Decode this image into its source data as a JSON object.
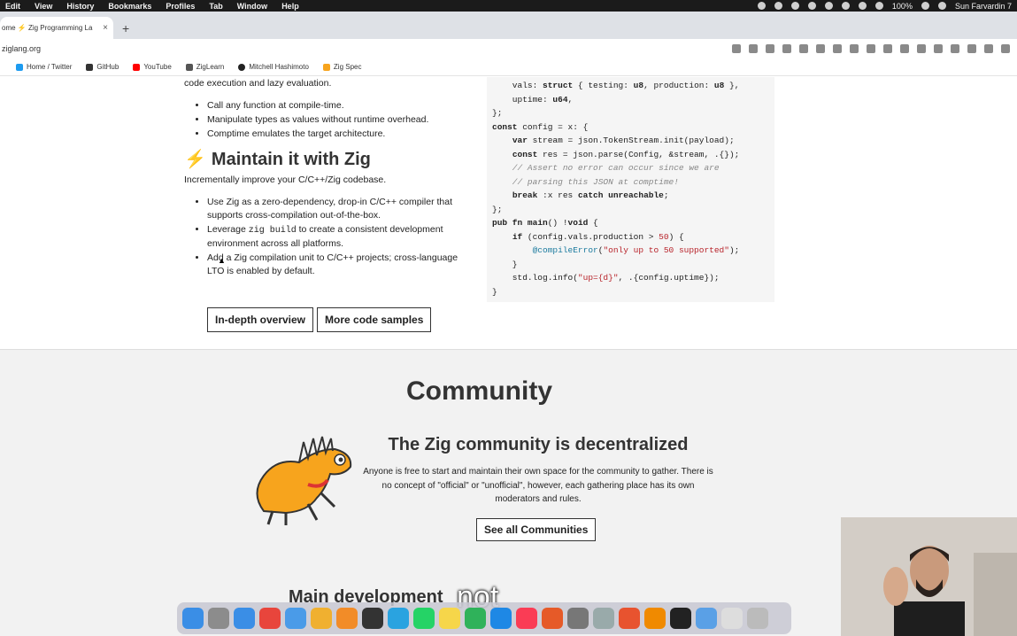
{
  "menubar": {
    "items": [
      "Edit",
      "View",
      "History",
      "Bookmarks",
      "Profiles",
      "Tab",
      "Window",
      "Help"
    ],
    "battery": "100%",
    "clock": "Sun Farvardin 7"
  },
  "tab": {
    "title": "ome ⚡ Zig Programming La",
    "close": "×",
    "new_tab": "+"
  },
  "address": {
    "url": "ziglang.org"
  },
  "bookmarks": [
    {
      "label": "Home / Twitter",
      "color": "#1d9bf0"
    },
    {
      "label": "GitHub",
      "color": "#333333"
    },
    {
      "label": "YouTube",
      "color": "#ff0000"
    },
    {
      "label": "ZigLearn",
      "color": "#555555"
    },
    {
      "label": "Mitchell Hashimoto",
      "color": "#222222"
    },
    {
      "label": "Zig Spec",
      "color": "#f7a41d"
    }
  ],
  "left": {
    "intro_tail": "code execution and lazy evaluation.",
    "comptime_bullets": [
      "Call any function at compile-time.",
      "Manipulate types as values without runtime overhead.",
      "Comptime emulates the target architecture."
    ],
    "maintain_heading": "Maintain it with Zig",
    "maintain_intro": "Incrementally improve your C/C++/Zig codebase.",
    "maintain_bullet1": "Use Zig as a zero-dependency, drop-in C/C++ compiler that supports cross-compilation out-of-the-box.",
    "maintain_bullet2_pre": "Leverage ",
    "maintain_bullet2_code": "zig build",
    "maintain_bullet2_post": " to create a consistent development environment across all platforms.",
    "maintain_bullet3": "Add a Zig compilation unit to C/C++ projects; cross-language LTO is enabled by default.",
    "btn_overview": "In-depth overview",
    "btn_samples": "More code samples"
  },
  "code": {
    "l1a": "    vals: ",
    "l1b": "struct",
    "l1c": " { testing: ",
    "l1d": "u8",
    "l1e": ", production: ",
    "l1f": "u8",
    "l1g": " },",
    "l2a": "    uptime: ",
    "l2b": "u64",
    "l2c": ",",
    "l3": "};",
    "l4a": "const",
    "l4b": " config = x: {",
    "l5a": "    ",
    "l5b": "var",
    "l5c": " stream = json.TokenStream.init(payload);",
    "l6a": "    ",
    "l6b": "const",
    "l6c": " res = json.parse(Config, &stream, .{});",
    "l7": "    // Assert no error can occur since we are",
    "l8": "    // parsing this JSON at comptime!",
    "l9a": "    ",
    "l9b": "break",
    "l9c": " :x res ",
    "l9d": "catch",
    "l9e": " ",
    "l9f": "unreachable",
    "l9g": ";",
    "l10": "};",
    "l11a": "pub fn",
    "l11b": " ",
    "l11c": "main",
    "l11d": "() !",
    "l11e": "void",
    "l11f": " {",
    "l12a": "    ",
    "l12b": "if",
    "l12c": " (config.vals.production > ",
    "l12d": "50",
    "l12e": ") {",
    "l13a": "        ",
    "l13b": "@compileError",
    "l13c": "(",
    "l13d": "\"only up to 50 supported\"",
    "l13e": ");",
    "l14": "    }",
    "l15a": "    std.log.info(",
    "l15b": "\"up={d}\"",
    "l15c": ", .{config.uptime});",
    "l16": "}"
  },
  "community": {
    "title": "Community",
    "subtitle": "The Zig community is decentralized",
    "text": "Anyone is free to start and maintain their own space for the community to gather. There is no concept of \"official\" or \"unofficial\", however, each gathering place has its own moderators and rules.",
    "button": "See all Communities",
    "next_heading": "Main development"
  },
  "caption": "not",
  "colors": {
    "accent": "#f7a41d",
    "code_bg": "#f5f5f5",
    "section_bg": "#f2f2f2"
  }
}
